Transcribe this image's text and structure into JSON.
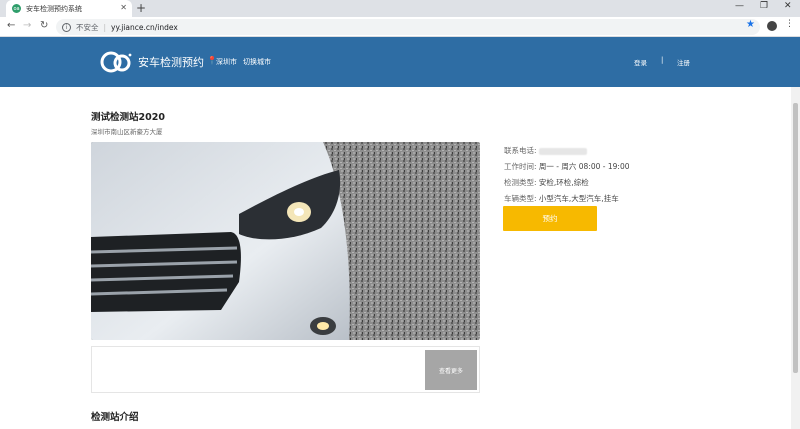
{
  "browser": {
    "tab_title": "安车检测预约系统",
    "favicon_text": "oa",
    "security_label": "不安全",
    "url": "yy.jiance.cn/index"
  },
  "header": {
    "site_title": "安车检测预约",
    "city": "深圳市",
    "switch_city": "切换城市",
    "login": "登录",
    "divider": "|",
    "register": "注册"
  },
  "station": {
    "name": "测试检测站2020",
    "address": "深圳市南山区新豪方大厦",
    "phone_label": "联系电话:",
    "hours_label": "工作时间:",
    "hours_value": "周一 - 周六 08:00 - 19:00",
    "inspect_label": "检测类型:",
    "inspect_value": "安检,环检,综检",
    "vehicle_label": "车辆类型:",
    "vehicle_value": "小型汽车,大型汽车,挂车",
    "book_label": "预约",
    "more_label": "查看更多"
  },
  "section": {
    "intro_title": "检测站介绍"
  },
  "colors": {
    "header_bg": "#2e6da4",
    "book_btn": "#f7b900",
    "more_btn": "#a6a6a6"
  }
}
